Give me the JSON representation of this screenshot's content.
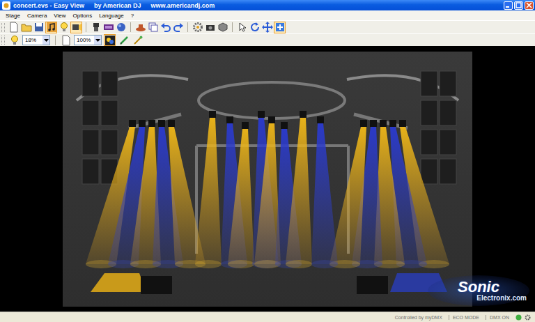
{
  "window": {
    "title": "concert.evs - Easy View",
    "publisher": "by American DJ",
    "url": "www.americandj.com"
  },
  "menu": [
    "Stage",
    "Camera",
    "View",
    "Options",
    "Language",
    "?"
  ],
  "toolbar_groups": [
    [
      {
        "pressed": false
      },
      {
        "pressed": false
      },
      {
        "pressed": false
      },
      {
        "pressed": true
      },
      {
        "pressed": false
      },
      {
        "pressed": true
      }
    ],
    [
      {
        "pressed": false
      },
      {
        "pressed": false
      },
      {
        "pressed": false
      }
    ],
    [
      {
        "pressed": false
      },
      {
        "pressed": false
      },
      {
        "pressed": false
      },
      {
        "pressed": false
      }
    ],
    [
      {
        "pressed": false
      },
      {
        "pressed": false
      },
      {
        "pressed": false
      }
    ],
    [
      {
        "pressed": false
      },
      {
        "pressed": false
      },
      {
        "pressed": false
      },
      {
        "pressed": true
      }
    ]
  ],
  "view_bar": {
    "light_level": "18%",
    "zoom": "100%",
    "tools": [
      {
        "pressed": true
      },
      {
        "pressed": false
      },
      {
        "pressed": false
      }
    ]
  },
  "watermark": {
    "brand": "Sonic",
    "site": "Electronix.com"
  },
  "status_bar": [
    "Controlled by myDMX",
    "ECO MODE",
    "DMX ON"
  ]
}
